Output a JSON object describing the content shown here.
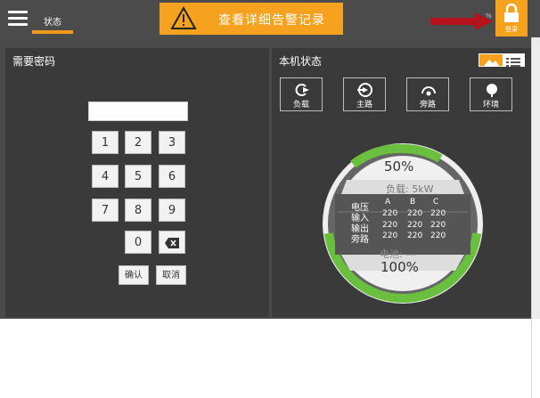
{
  "topbar": {
    "tab_status": "状态",
    "alarm_label": "查看详细告警记录",
    "login_label": "登录",
    "tiny_mark": "%"
  },
  "left_panel": {
    "title": "需要密码",
    "password_value": "",
    "keys": [
      "1",
      "2",
      "3",
      "4",
      "5",
      "6",
      "7",
      "8",
      "9",
      "0"
    ],
    "backspace_icon": "backspace-icon",
    "confirm_label": "确认",
    "cancel_label": "取消"
  },
  "right_panel": {
    "title": "本机状态",
    "view_buttons": [
      {
        "label": "负载",
        "icon": "load-icon"
      },
      {
        "label": "主路",
        "icon": "mains-icon"
      },
      {
        "label": "旁路",
        "icon": "bypass-icon"
      },
      {
        "label": "环境",
        "icon": "environment-icon"
      }
    ],
    "gauge": {
      "load_percent": "50%",
      "load_fraction": 0.5,
      "load_power": "负载: 5kW",
      "voltage_header": "电压",
      "phase_a": "A",
      "phase_b": "B",
      "phase_c": "C",
      "rows": [
        {
          "label": "输入",
          "values": [
            "220",
            "220",
            "220"
          ]
        },
        {
          "label": "输出",
          "values": [
            "220",
            "220",
            "220"
          ]
        },
        {
          "label": "旁路",
          "values": [
            "220",
            "220",
            "220"
          ]
        }
      ],
      "battery_label": "电池: ---",
      "battery_percent": "100%",
      "battery_fraction": 1.0
    }
  },
  "colors": {
    "accent": "#f7a21f",
    "gauge_green": "#6bbf3f",
    "arrow_red": "#b5121b"
  }
}
